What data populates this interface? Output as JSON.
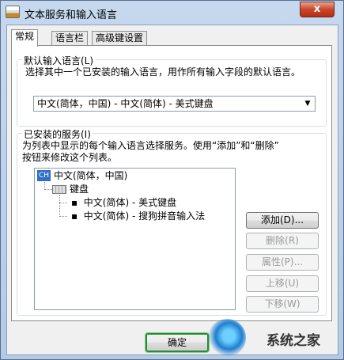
{
  "window": {
    "title": "文本服务和输入语言",
    "close_label": "x"
  },
  "tabs": [
    {
      "label": "常规"
    },
    {
      "label": "语言栏"
    },
    {
      "label": "高级键设置"
    }
  ],
  "default_language": {
    "group_title": "默认输入语言(L)",
    "description": "选择其中一个已安装的输入语言，用作所有输入字段的默认语言。",
    "selected": "中文(简体，中国) - 中文(简体) - 美式键盘",
    "arrow_icon": "triangle-down-icon"
  },
  "installed_services": {
    "group_title": "已安装的服务(I)",
    "description_line1": "为列表中显示的每个输入语言选择服务。使用“添加”和“删除”",
    "description_line2": "按钮来修改这个列表。",
    "tree": {
      "language_badge": "CH",
      "language": "中文(简体，中国)",
      "category": "键盘",
      "items": [
        "中文(简体) - 美式键盘",
        "中文(简体) - 搜狗拼音输入法"
      ]
    },
    "buttons": {
      "add": "添加(D)...",
      "remove": "删除(R)",
      "properties": "属性(P)...",
      "move_up": "上移(U)",
      "move_down": "下移(W)"
    }
  },
  "footer": {
    "ok_label": "确定"
  },
  "watermark": {
    "text": "系统之家"
  }
}
